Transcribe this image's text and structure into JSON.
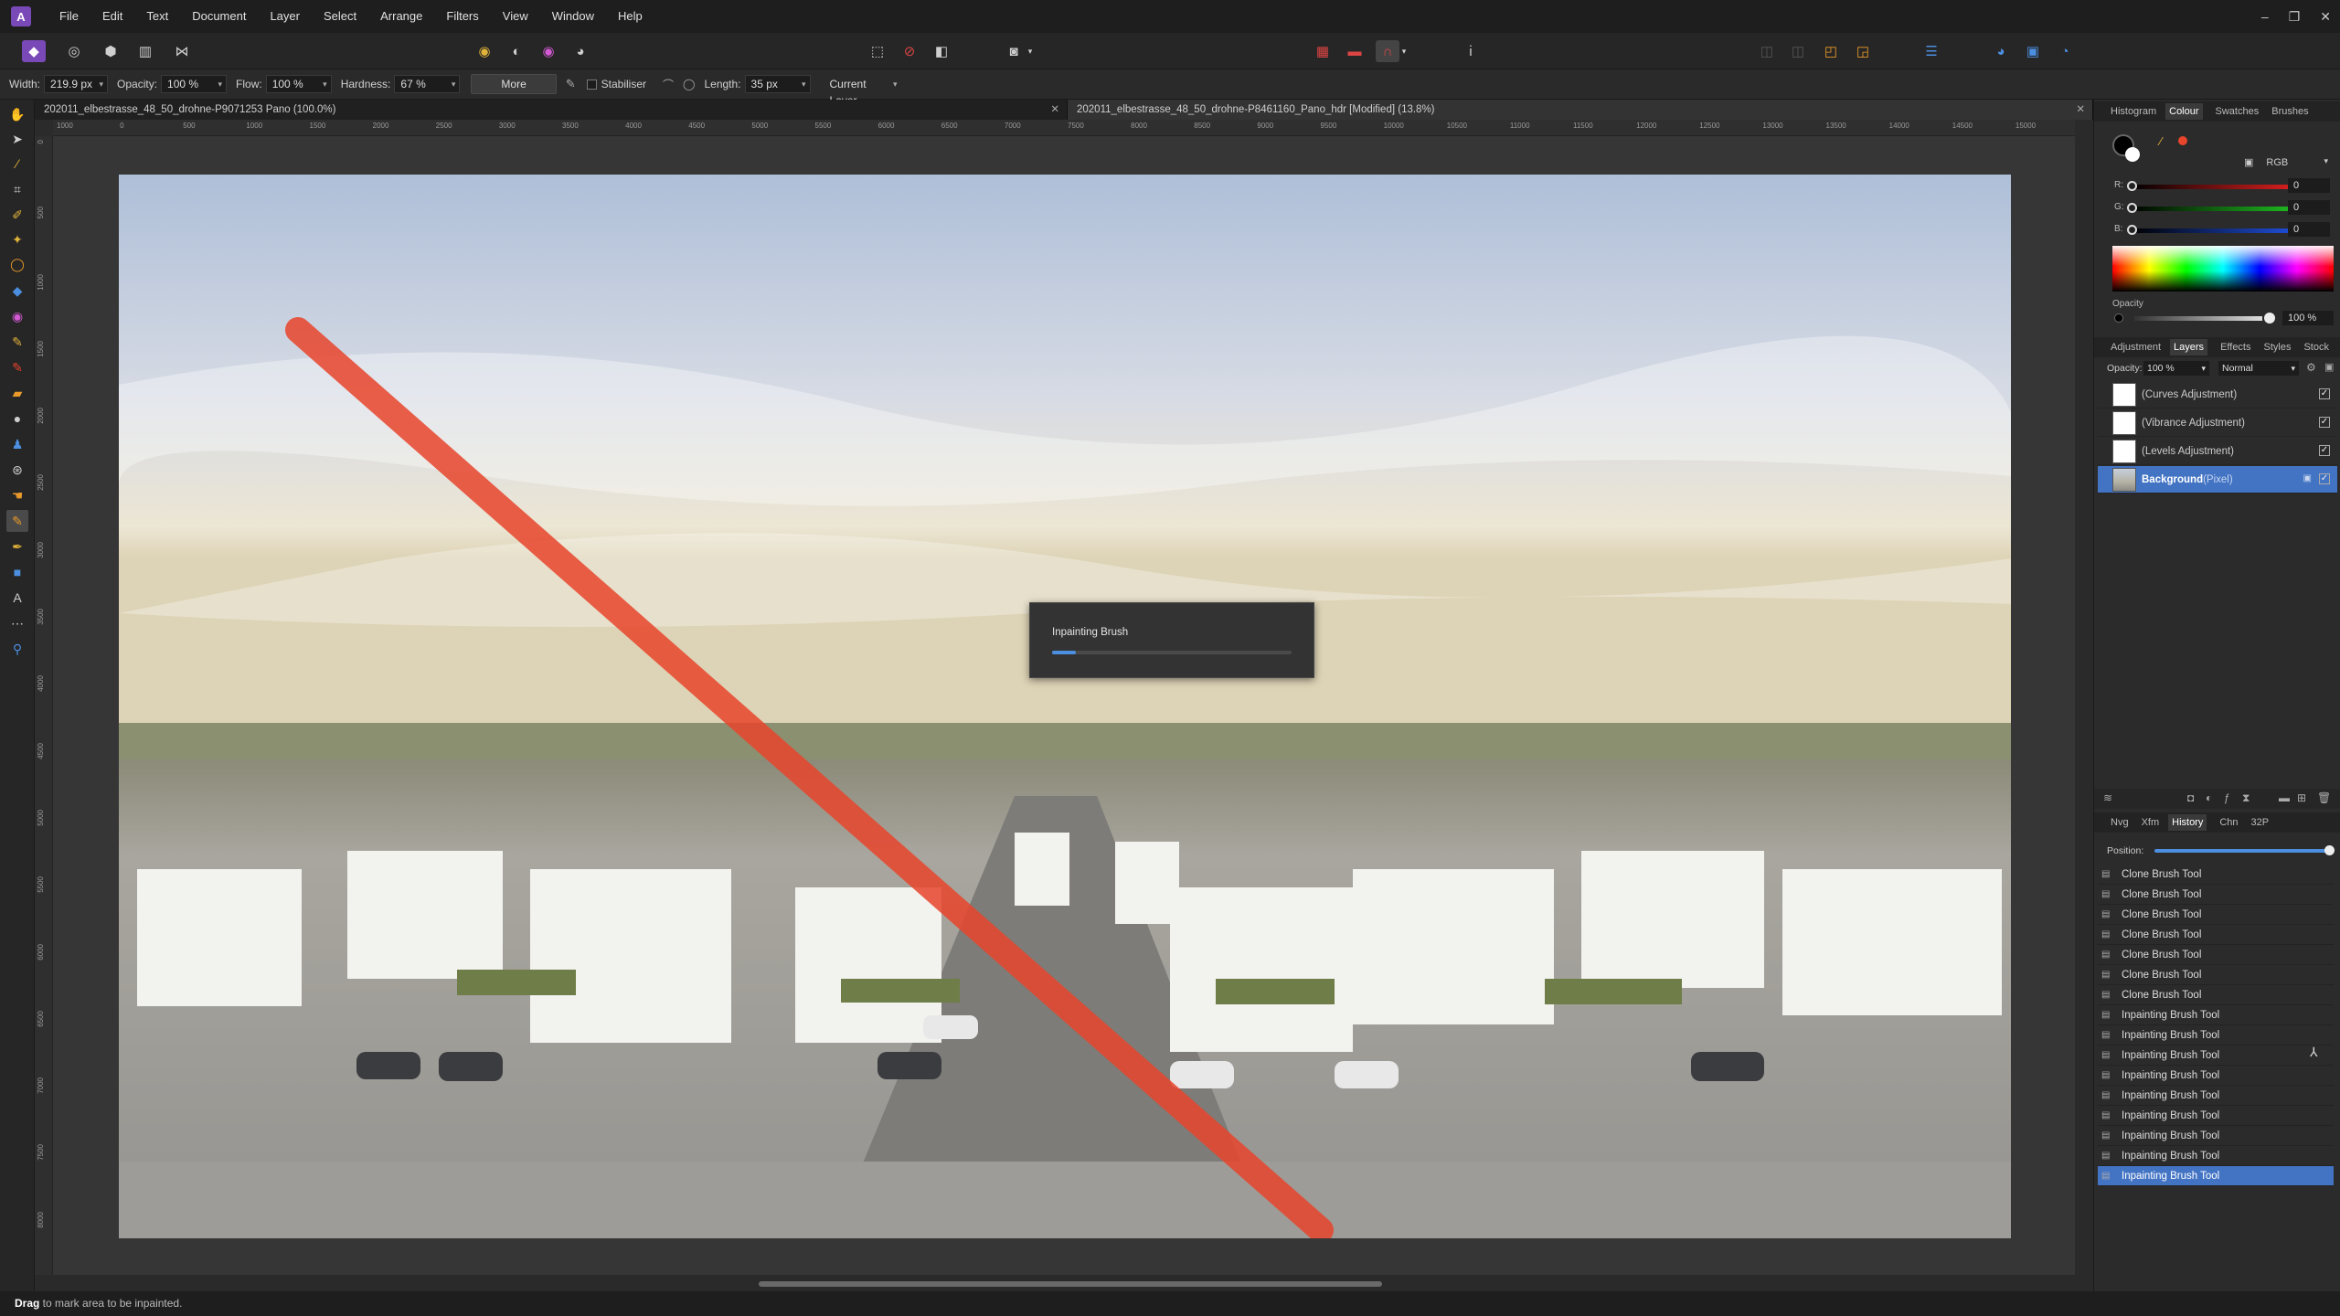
{
  "menu": [
    "File",
    "Edit",
    "Text",
    "Document",
    "Layer",
    "Select",
    "Arrange",
    "Filters",
    "View",
    "Window",
    "Help"
  ],
  "context": {
    "width_label": "Width:",
    "width_value": "219.9 px",
    "opacity_label": "Opacity:",
    "opacity_value": "100 %",
    "flow_label": "Flow:",
    "flow_value": "100 %",
    "hardness_label": "Hardness:",
    "hardness_value": "67 %",
    "more_label": "More",
    "stabiliser_label": "Stabiliser",
    "length_label": "Length:",
    "length_value": "35 px",
    "source_value": "Current Layer"
  },
  "tabs": [
    {
      "label": "202011_elbestrasse_48_50_drohne-P9071253 Pano (100.0%)"
    },
    {
      "label": "202011_elbestrasse_48_50_drohne-P8461160_Pano_hdr [Modified] (13.8%)"
    }
  ],
  "hruler_labels": [
    "1000",
    "0",
    "500",
    "1000",
    "1500",
    "2000",
    "2500",
    "3000",
    "3500",
    "4000",
    "4500",
    "5000",
    "5500",
    "6000",
    "6500",
    "7000",
    "7500",
    "8000",
    "8500",
    "9000",
    "9500",
    "10000",
    "10500",
    "11000",
    "11500",
    "12000",
    "12500",
    "13000",
    "13500",
    "14000",
    "14500",
    "15000"
  ],
  "vruler_labels": [
    "0",
    "500",
    "1000",
    "1500",
    "2000",
    "2500",
    "3000",
    "3500",
    "4000",
    "4500",
    "5000",
    "5500",
    "6000",
    "6500",
    "7000",
    "7500",
    "8000"
  ],
  "dialog": {
    "title": "Inpainting Brush",
    "progress": 0.1
  },
  "status": {
    "bold": "Drag",
    "text": " to mark area to be inpainted."
  },
  "colour_panel": {
    "tabs": [
      "Histogram",
      "Colour",
      "Swatches",
      "Brushes"
    ],
    "active": "Colour",
    "model": "RGB",
    "r_label": "R:",
    "r_value": "0",
    "g_label": "G:",
    "g_value": "0",
    "b_label": "B:",
    "b_value": "0",
    "opacity_label": "Opacity",
    "opacity_value": "100 %"
  },
  "layers_panel": {
    "tabs": [
      "Adjustment",
      "Layers",
      "Effects",
      "Styles",
      "Stock"
    ],
    "active": "Layers",
    "opacity_label": "Opacity:",
    "opacity_value": "100 %",
    "blend_mode": "Normal",
    "layers": [
      {
        "name": "(Curves Adjustment)",
        "selected": false
      },
      {
        "name": "(Vibrance Adjustment)",
        "selected": false
      },
      {
        "name": "(Levels Adjustment)",
        "selected": false
      },
      {
        "name": "Background",
        "suffix": " (Pixel)",
        "selected": true
      }
    ]
  },
  "history_panel": {
    "tabs": [
      "Nvg",
      "Xfm",
      "History",
      "Chn",
      "32P"
    ],
    "active": "History",
    "position_label": "Position:",
    "items": [
      "Clone Brush Tool",
      "Clone Brush Tool",
      "Clone Brush Tool",
      "Clone Brush Tool",
      "Clone Brush Tool",
      "Clone Brush Tool",
      "Clone Brush Tool",
      "Inpainting Brush Tool",
      "Inpainting Brush Tool",
      "Inpainting Brush Tool",
      "Inpainting Brush Tool",
      "Inpainting Brush Tool",
      "Inpainting Brush Tool",
      "Inpainting Brush Tool",
      "Inpainting Brush Tool",
      "Inpainting Brush Tool"
    ],
    "selected_index": 15
  },
  "colors": {
    "accent": "#4374c4",
    "brush_stroke": "#e8452c",
    "swatch_primary": "#000000",
    "swatch_secondary": "#ffffff",
    "swatch_accent": "#e8452c"
  }
}
